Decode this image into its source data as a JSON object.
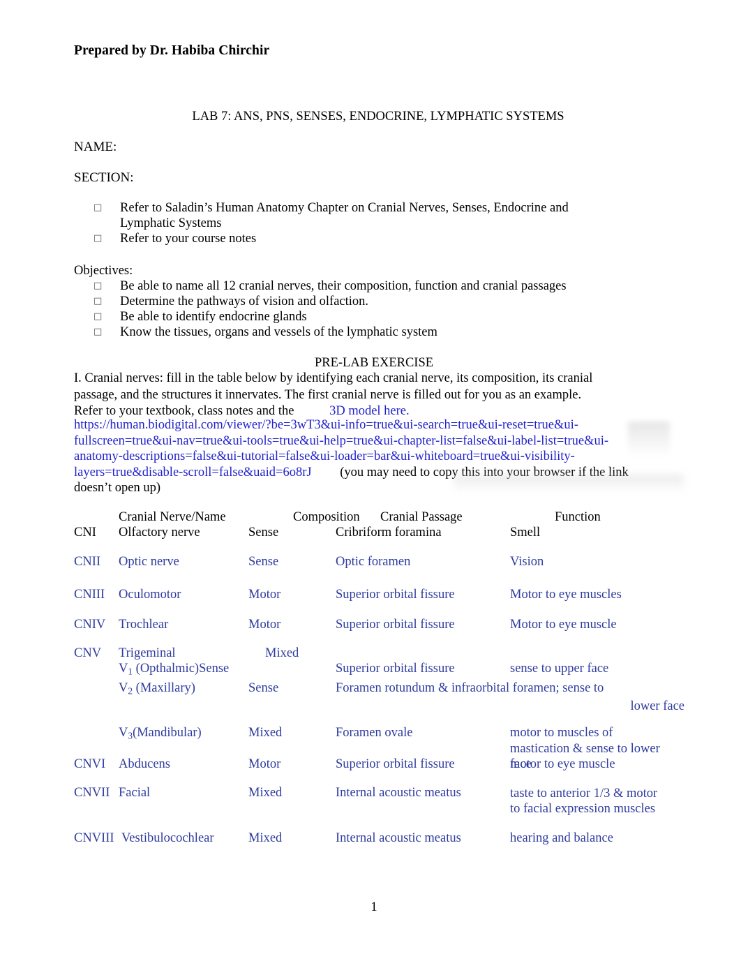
{
  "header": {
    "prepared_by": "Prepared by Dr. Habiba Chirchir"
  },
  "document": {
    "title": "LAB 7: ANS, PNS, SENSES, ENDOCRINE, LYMPHATIC SYSTEMS",
    "name_label": "NAME:",
    "section_label": "SECTION:",
    "bullet_glyph": "□",
    "intro_bullets": [
      "Refer to Saladin’s Human Anatomy Chapter on Cranial Nerves, Senses, Endocrine and Lymphatic Systems",
      "Refer to your course notes"
    ],
    "objectives_label": "Objectives:",
    "objectives": [
      "Be able to name all 12 cranial nerves, their composition, function and cranial passages",
      "Determine the pathways of vision and olfaction.",
      "Be able to identify endocrine glands",
      "Know the tissues, organs and vessels of the lymphatic system"
    ],
    "prelab_title": "PRE-LAB EXERCISE",
    "instructions_part1": "I. Cranial nerves: fill in the table below by identifying each cranial nerve, its composition, its cranial passage, and the structures it innervates. The first cranial nerve is filled out for you as an example.",
    "instructions_part2": "Refer to your textbook, class notes and the",
    "link_text": "3D model here.",
    "url_text": "https://human.biodigital.com/viewer/?be=3wT3&ui-info=true&ui-search=true&ui-reset=true&ui-fullscreen=true&ui-nav=true&ui-tools=true&ui-help=true&ui-chapter-list=false&ui-label-list=true&ui-anatomy-descriptions=false&ui-tutorial=false&ui-loader=bar&ui-whiteboard=true&ui-visibility-layers=true&disable-scroll=false&uaid=6o8rJ",
    "url_tail_note": "(you may need to copy this into your browser if the link doesn’t open up)",
    "page_number": "1"
  },
  "table": {
    "headers": {
      "nerve": "Cranial Nerve/Name",
      "composition": "Composition",
      "passage": "Cranial Passage",
      "function": "Function"
    },
    "example_row": {
      "code": "CNI",
      "name": "Olfactory nerve",
      "composition": "Sense",
      "passage": "Cribriform foramina",
      "function": "Smell"
    },
    "rows": [
      {
        "code": "CNII",
        "name": "Optic nerve",
        "composition": "Sense",
        "passage": "Optic foramen",
        "function": "Vision"
      },
      {
        "code": "CNIII",
        "name": "Oculomotor",
        "composition": "Motor",
        "passage": "Superior orbital fissure",
        "function": "Motor to eye muscles"
      },
      {
        "code": "CNIV",
        "name": "Trochlear",
        "composition": "Motor",
        "passage": "Superior orbital fissure",
        "function": "Motor to eye muscle"
      },
      {
        "code": "CNV",
        "name": "Trigeminal",
        "composition": "Mixed",
        "passage": "",
        "function": ""
      },
      {
        "code": "CNVI",
        "name": "Abducens",
        "composition": "Motor",
        "passage": "Superior orbital fissure",
        "function": "motor to eye muscle"
      },
      {
        "code": "CNVII",
        "name": "Facial",
        "composition": "Mixed",
        "passage": "Internal acoustic meatus",
        "function": "taste to anterior 1/3 & motor to facial expression muscles"
      },
      {
        "code": "CNVIII",
        "name": "Vestibulocochlear",
        "composition": "Mixed",
        "passage": "Internal acoustic meatus",
        "function": "hearing and balance"
      }
    ],
    "trigeminal_branches": [
      {
        "label_prefix": "V",
        "label_sub": "1",
        "label_suffix": " (Opthalmic)",
        "composition_inline": "Sense",
        "composition": "",
        "passage": "Superior orbital fissure",
        "function": "sense to upper face"
      },
      {
        "label_prefix": "V",
        "label_sub": "2",
        "label_suffix": " (Maxillary)",
        "composition_inline": "",
        "composition": "Sense",
        "passage": "Foramen rotundum & infraorbital foramen; sense to",
        "function": ""
      },
      {
        "label_prefix": "V",
        "label_sub": "3",
        "label_suffix": "(Mandibular)",
        "composition_inline": "",
        "composition": "Mixed",
        "passage": "Foramen ovale",
        "function": "motor to muscles of mastication & sense to lower face"
      }
    ],
    "lower_face_tail": "lower face"
  }
}
